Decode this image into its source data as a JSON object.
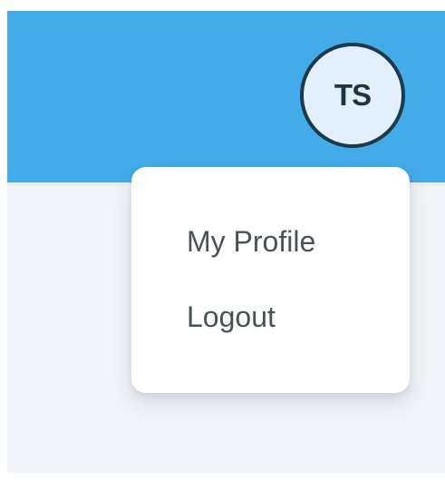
{
  "header": {
    "avatar": {
      "initials": "TS"
    }
  },
  "user_menu": {
    "items": [
      {
        "label": "My Profile"
      },
      {
        "label": "Logout"
      }
    ]
  },
  "colors": {
    "header_bg": "#42abe8",
    "content_bg": "#f1f4f8",
    "avatar_bg": "#e3effb",
    "avatar_border": "#1e3a4a",
    "menu_text": "#48525b"
  }
}
